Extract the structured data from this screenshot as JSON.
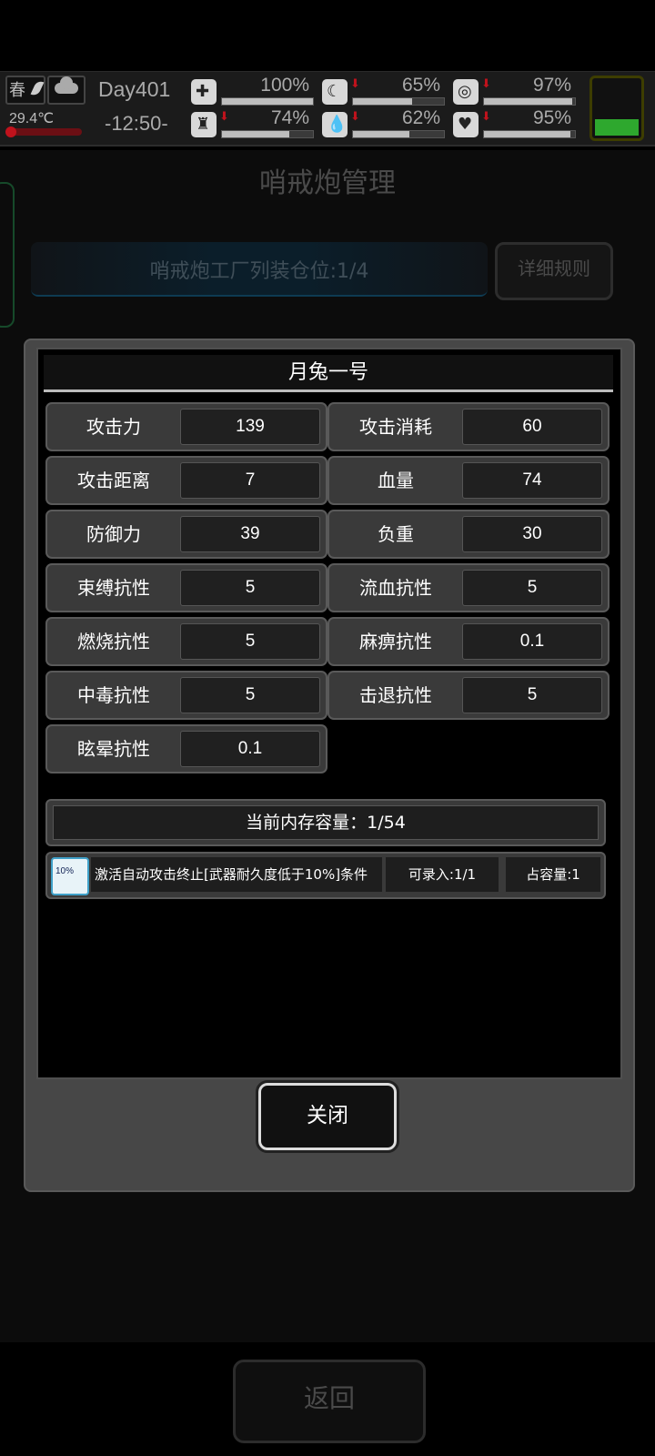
{
  "status": {
    "season": "春",
    "temperature": "29.4℃",
    "day": "Day401",
    "time": "-12:50-",
    "stats": [
      {
        "name": "medkit-icon",
        "glyph": "✚",
        "percent": "100%",
        "value": 1.0,
        "down": false
      },
      {
        "name": "stomach-icon",
        "glyph": "☾",
        "percent": "65%",
        "value": 0.65,
        "down": true
      },
      {
        "name": "pill-icon",
        "glyph": "◎",
        "percent": "97%",
        "value": 0.97,
        "down": true
      },
      {
        "name": "leg-icon",
        "glyph": "♜",
        "percent": "74%",
        "value": 0.74,
        "down": true
      },
      {
        "name": "water-drop-icon",
        "glyph": "💧",
        "percent": "62%",
        "value": 0.62,
        "down": true
      },
      {
        "name": "heart-icon",
        "glyph": "♥",
        "percent": "95%",
        "value": 0.95,
        "down": true
      }
    ],
    "battery_level": 0.3
  },
  "page": {
    "title": "哨戒炮管理",
    "factory_slots": "哨戒炮工厂列装仓位:1/4",
    "rules_button": "详细规则",
    "back_button": "返回"
  },
  "modal": {
    "title": "月兔一号",
    "stats": [
      {
        "label": "攻击力",
        "value": "139"
      },
      {
        "label": "攻击消耗",
        "value": "60"
      },
      {
        "label": "攻击距离",
        "value": "7"
      },
      {
        "label": "血量",
        "value": "74"
      },
      {
        "label": "防御力",
        "value": "39"
      },
      {
        "label": "负重",
        "value": "30"
      },
      {
        "label": "束缚抗性",
        "value": "5"
      },
      {
        "label": "流血抗性",
        "value": "5"
      },
      {
        "label": "燃烧抗性",
        "value": "5"
      },
      {
        "label": "麻痹抗性",
        "value": "0.1"
      },
      {
        "label": "中毒抗性",
        "value": "5"
      },
      {
        "label": "击退抗性",
        "value": "5"
      },
      {
        "label": "眩晕抗性",
        "value": "0.1"
      }
    ],
    "memory": "当前内存容量：1/54",
    "condition": {
      "icon_text": "10%",
      "text": "激活自动攻击终止[武器耐久度低于10%]条件",
      "recordable": "可录入:1/1",
      "capacity": "占容量:1"
    },
    "close_button": "关闭"
  }
}
